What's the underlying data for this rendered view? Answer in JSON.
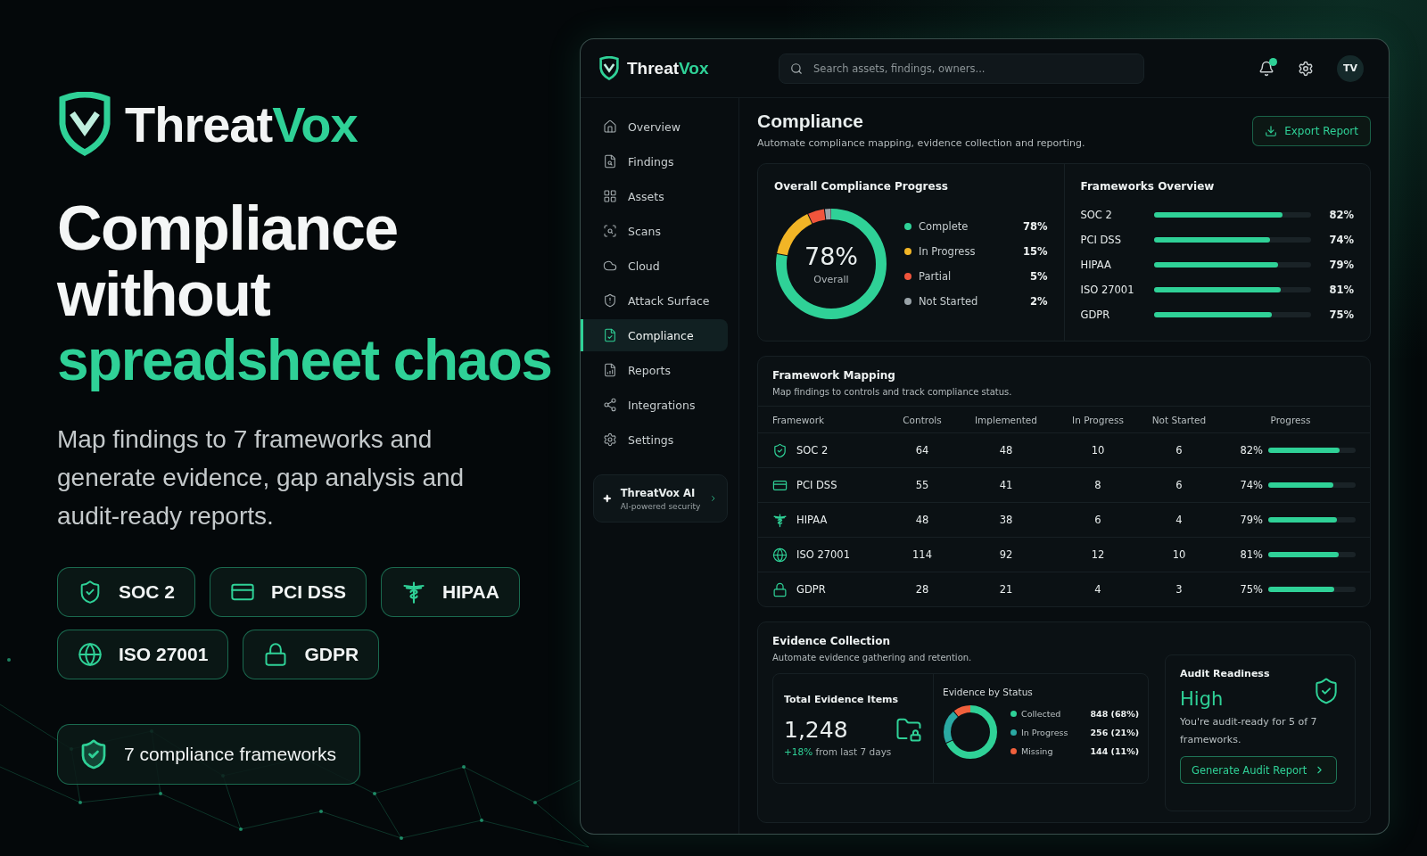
{
  "hero": {
    "logo": {
      "first": "Threat",
      "second": "Vox"
    },
    "headline": [
      "Compliance",
      "without"
    ],
    "highlight": "spreadsheet chaos",
    "description": "Map findings to 7 frameworks and generate evidence, gap analysis and audit-ready reports.",
    "badges": [
      "SOC 2",
      "PCI DSS",
      "HIPAA",
      "ISO 27001",
      "GDPR"
    ],
    "summary": "7 compliance frameworks"
  },
  "app": {
    "brand": {
      "first": "Threat",
      "second": "Vox"
    },
    "search": {
      "placeholder": "Search assets, findings, owners..."
    },
    "notification": true,
    "avatar": "TV",
    "nav": [
      {
        "label": "Overview",
        "selected": false
      },
      {
        "label": "Findings",
        "selected": false
      },
      {
        "label": "Assets",
        "selected": false
      },
      {
        "label": "Scans",
        "selected": false
      },
      {
        "label": "Cloud",
        "selected": false
      },
      {
        "label": "Attack Surface",
        "selected": false
      },
      {
        "label": "Compliance",
        "selected": true
      },
      {
        "label": "Reports",
        "selected": false
      },
      {
        "label": "Integrations",
        "selected": false
      },
      {
        "label": "Settings",
        "selected": false
      }
    ],
    "ai_card": {
      "title": "ThreatVox AI",
      "subtitle": "AI-powered security"
    },
    "page": {
      "title": "Compliance",
      "subtitle": "Automate compliance mapping, evidence collection and reporting.",
      "export": "Export Report"
    },
    "overall": {
      "title": "Overall Compliance Progress",
      "center_value": "78%",
      "center_label": "Overall",
      "legend": [
        {
          "label": "Complete",
          "value": "78%",
          "color": "#2fd197"
        },
        {
          "label": "In Progress",
          "value": "15%",
          "color": "#f2b526"
        },
        {
          "label": "Partial",
          "value": "5%",
          "color": "#f0553c"
        },
        {
          "label": "Not Started",
          "value": "2%",
          "color": "#9aa3a8"
        }
      ]
    },
    "frameworks_overview": {
      "title": "Frameworks Overview",
      "items": [
        {
          "name": "SOC 2",
          "value": "82%",
          "level": 0.82
        },
        {
          "name": "PCI DSS",
          "value": "74%",
          "level": 0.74
        },
        {
          "name": "HIPAA",
          "value": "79%",
          "level": 0.79
        },
        {
          "name": "ISO 27001",
          "value": "81%",
          "level": 0.81
        },
        {
          "name": "GDPR",
          "value": "75%",
          "level": 0.75
        }
      ]
    },
    "mapping": {
      "title": "Framework Mapping",
      "subtitle": "Map findings to controls and track compliance status.",
      "columns": [
        "Framework",
        "Controls",
        "Implemented",
        "In Progress",
        "Not Started",
        "Progress"
      ],
      "rows": [
        {
          "framework": "SOC 2",
          "controls": "64",
          "implemented": "48",
          "in_progress": "10",
          "not_started": "6",
          "progress": "82%",
          "level": 0.82
        },
        {
          "framework": "PCI DSS",
          "controls": "55",
          "implemented": "41",
          "in_progress": "8",
          "not_started": "6",
          "progress": "74%",
          "level": 0.74
        },
        {
          "framework": "HIPAA",
          "controls": "48",
          "implemented": "38",
          "in_progress": "6",
          "not_started": "4",
          "progress": "79%",
          "level": 0.79
        },
        {
          "framework": "ISO 27001",
          "controls": "114",
          "implemented": "92",
          "in_progress": "12",
          "not_started": "10",
          "progress": "81%",
          "level": 0.81
        },
        {
          "framework": "GDPR",
          "controls": "28",
          "implemented": "21",
          "in_progress": "4",
          "not_started": "3",
          "progress": "75%",
          "level": 0.75
        }
      ]
    },
    "evidence": {
      "title": "Evidence Collection",
      "subtitle": "Automate evidence gathering and retention.",
      "total": {
        "title": "Total Evidence Items",
        "value": "1,248",
        "change": "+18%",
        "period": "from last 7 days"
      },
      "status": {
        "title": "Evidence by Status",
        "items": [
          {
            "label": "Collected",
            "value": "848 (68%)",
            "color": "#2fd197"
          },
          {
            "label": "In Progress",
            "value": "256 (21%)",
            "color": "#2aa9a3"
          },
          {
            "label": "Missing",
            "value": "144 (11%)",
            "color": "#f0603c"
          }
        ]
      }
    },
    "audit": {
      "title": "Audit Readiness",
      "level_text": "High",
      "text": "You're audit-ready for 5 of 7 frameworks.",
      "button": "Generate Audit Report"
    }
  }
}
